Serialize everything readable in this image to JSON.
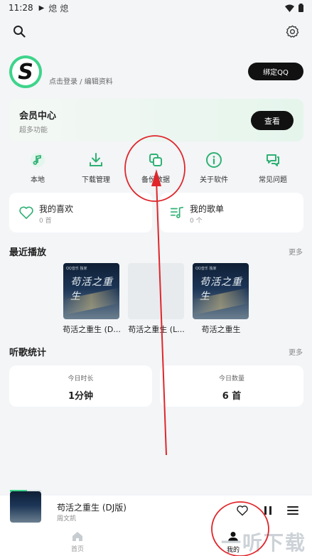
{
  "status_bar": {
    "time": "11:28",
    "flame_icons": [
      "熄",
      "熄"
    ]
  },
  "profile": {
    "avatar_letter": "S",
    "login_text": "点击登录 / 编辑资料",
    "bind_label": "绑定QQ"
  },
  "vip": {
    "title": "会员中心",
    "subtitle": "超多功能",
    "button_label": "查看"
  },
  "shortcuts": [
    {
      "label": "本地",
      "icon": "music-note-icon"
    },
    {
      "label": "下载管理",
      "icon": "download-icon"
    },
    {
      "label": "备份数据",
      "icon": "copy-icon"
    },
    {
      "label": "关于软件",
      "icon": "info-icon"
    },
    {
      "label": "常见问题",
      "icon": "chat-icon"
    }
  ],
  "collections": {
    "favorites": {
      "title": "我的喜欢",
      "count": "0 首"
    },
    "playlists": {
      "title": "我的歌单",
      "count": "0 个"
    }
  },
  "recent": {
    "title": "最近播放",
    "more": "更多",
    "items": [
      {
        "name": "苟活之重生 (D...",
        "cover_text": "苟活之重生",
        "tag": "QQ音乐 独家"
      },
      {
        "name": "苟活之重生 (L...",
        "cover_text": "",
        "tag": ""
      },
      {
        "name": "苟活之重生",
        "cover_text": "苟活之重生",
        "tag": "QQ音乐 独家"
      }
    ]
  },
  "stats": {
    "title": "听歌统计",
    "more": "更多",
    "today_duration": {
      "label": "今日时长",
      "value": "1分钟"
    },
    "today_count": {
      "label": "今日数量",
      "value": "6 首"
    }
  },
  "player": {
    "title": "苟活之重生 (DJ版)",
    "artist": "周文凯",
    "progress": 0.55
  },
  "tabs": [
    {
      "label": "首页",
      "active": false
    },
    {
      "label": "我的",
      "active": true
    }
  ],
  "watermark": "一听下载",
  "colors": {
    "accent": "#3ed48b",
    "annotation": "#e0262b"
  }
}
